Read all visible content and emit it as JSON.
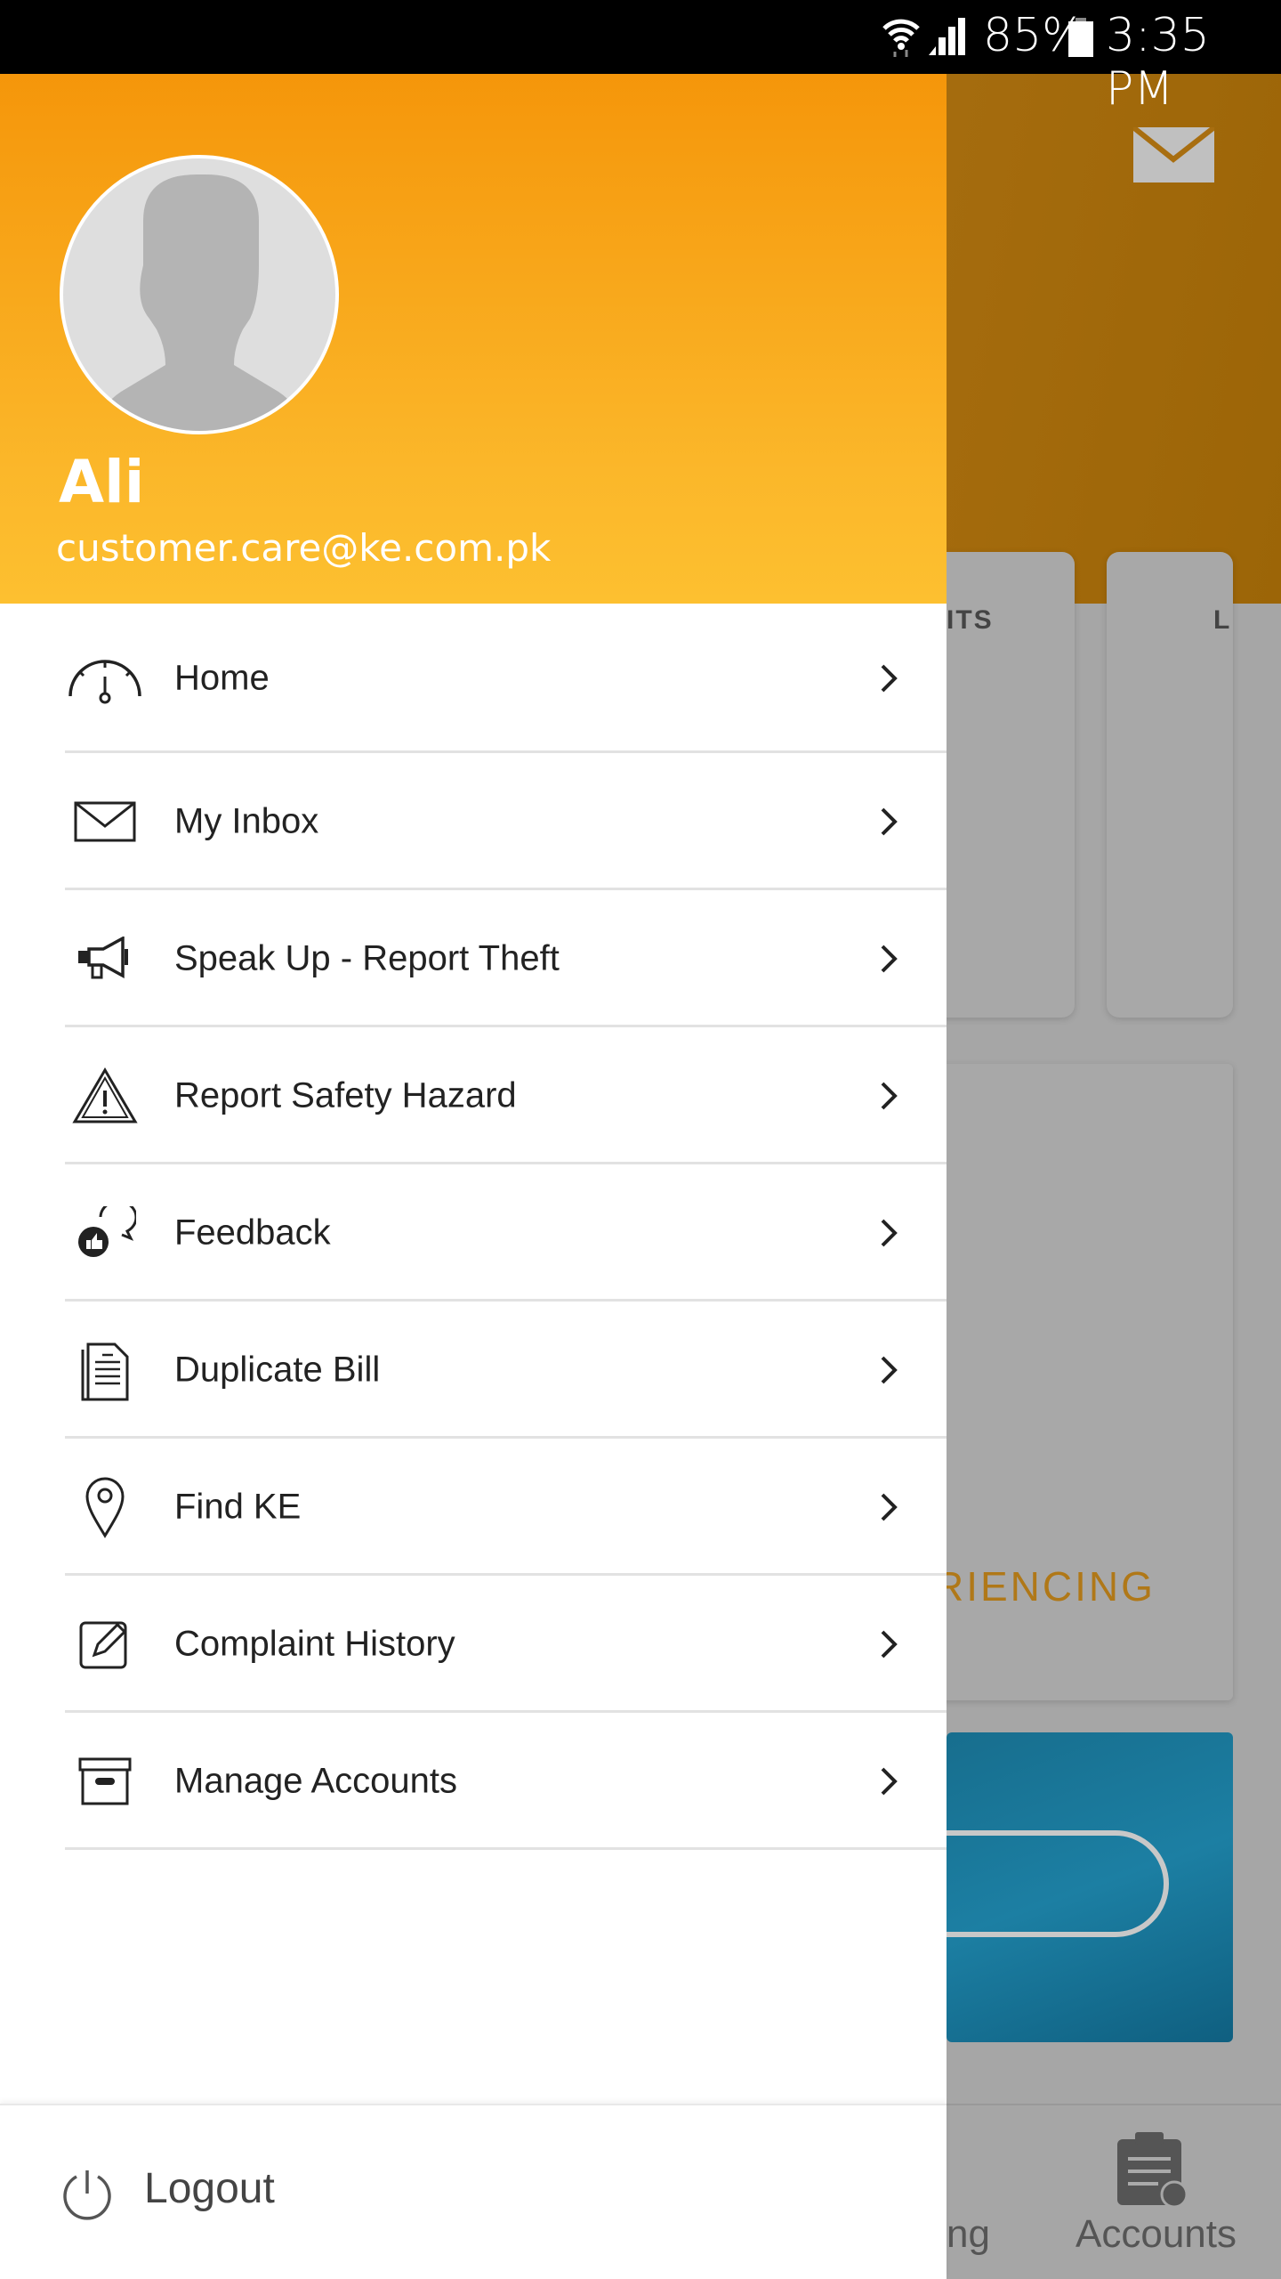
{
  "status_bar": {
    "battery": "85%",
    "time": "3:35 PM",
    "icons": [
      "wifi-icon",
      "signal-icon",
      "battery-icon"
    ]
  },
  "drawer": {
    "user_name": "Ali",
    "user_email": "customer.care@ke.com.pk",
    "items": [
      {
        "label": "Home",
        "icon": "speedometer-icon"
      },
      {
        "label": "My Inbox",
        "icon": "envelope-icon"
      },
      {
        "label": "Speak Up - Report Theft",
        "icon": "megaphone-icon"
      },
      {
        "label": "Report Safety Hazard",
        "icon": "warning-icon"
      },
      {
        "label": "Feedback",
        "icon": "feedback-icon"
      },
      {
        "label": "Duplicate Bill",
        "icon": "document-icon"
      },
      {
        "label": "Find KE",
        "icon": "location-pin-icon"
      },
      {
        "label": "Complaint History",
        "icon": "edit-icon"
      },
      {
        "label": "Manage Accounts",
        "icon": "archive-box-icon"
      }
    ],
    "logout_label": "Logout"
  },
  "background": {
    "card1_text": "ITS",
    "card2_text": "L",
    "banner_text": "RIENCING",
    "nav_partial": "ng",
    "nav_accounts": "Accounts"
  },
  "colors": {
    "accent": "#f5960a",
    "header_bottom": "#fdc030"
  }
}
